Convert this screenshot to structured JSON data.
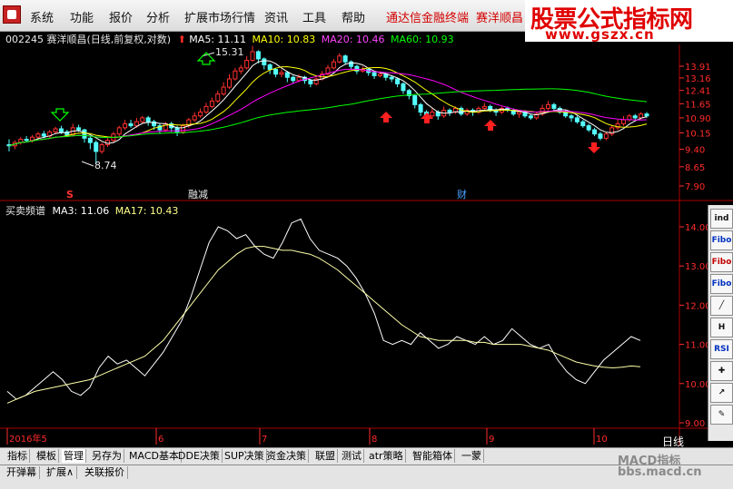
{
  "menu": {
    "items": [
      "系统",
      "功能",
      "报价",
      "分析",
      "扩展市场行情",
      "资讯",
      "工具",
      "帮助"
    ],
    "link_terminal": "通达信金融终端",
    "link_stock": "赛洋顺昌"
  },
  "watermark": {
    "title": "股票公式指标网",
    "url": "www.gszx.cn"
  },
  "header": {
    "code": "002245",
    "name_mode": "赛洋顺昌(日线,前复权,对数)",
    "ma5": "MA5: 11.11",
    "ma10": "MA10: 10.83",
    "ma20": "MA20: 10.46",
    "ma60": "MA60: 10.93"
  },
  "colors": {
    "candle_up": "#ff3030",
    "candle_down": "#54ffff",
    "ma5": "#ffffff",
    "ma10": "#ffff00",
    "ma20": "#ff00ff",
    "ma60": "#00ff00",
    "axis": "#ff2b2b",
    "grid": "#aa0000"
  },
  "annotations": {
    "high_label": "15.31",
    "low_label": "8.74",
    "marker_s": "S",
    "marker_rongzi": "融减",
    "marker_cai": "财"
  },
  "indicator": {
    "title": "买卖频谱",
    "ma3": "MA3: 11.06",
    "ma17": "MA17: 10.43"
  },
  "price_axis": [
    "13.91",
    "13.16",
    "12.41",
    "11.65",
    "10.90",
    "10.15",
    "9.40",
    "8.65",
    "7.90"
  ],
  "indicator_axis": [
    "14.00",
    "13.00",
    "12.00",
    "11.00",
    "10.00",
    "9.00"
  ],
  "date_axis": [
    "2016年5",
    "6",
    "7",
    "8",
    "9",
    "10"
  ],
  "period_label": "日线",
  "sidebar_buttons": [
    "ind",
    "Fibo",
    "Fibo",
    "Fibo",
    "H",
    "RSI"
  ],
  "tabs": [
    "指标",
    "模板",
    "管理",
    "另存为",
    "MACD基本",
    "DDE决策",
    "SUP决策",
    "资金决策",
    "联盟",
    "测试",
    "atr策略",
    "智能箱体",
    "一蒙"
  ],
  "bottom_buttons": [
    "开弹幕",
    "扩展∧",
    "关联报价"
  ],
  "macd_watermark_1": "MACD指标",
  "macd_watermark_2": "bbs.macd.cn",
  "chart_data": {
    "type": "candlestick",
    "x": [
      "2016-05",
      "2016-06",
      "2016-07",
      "2016-08",
      "2016-09",
      "2016-10"
    ],
    "ohlc_series": {
      "name": "",
      "values": [
        [
          9.6,
          9.55,
          9.85,
          9.3
        ],
        [
          9.55,
          9.7,
          9.8,
          9.4
        ],
        [
          9.7,
          9.85,
          9.95,
          9.6
        ],
        [
          9.85,
          9.8,
          10.0,
          9.7
        ],
        [
          9.8,
          9.95,
          10.05,
          9.7
        ],
        [
          9.95,
          10.1,
          10.2,
          9.85
        ],
        [
          10.1,
          10.0,
          10.25,
          9.9
        ],
        [
          10.0,
          10.2,
          10.3,
          9.9
        ],
        [
          10.2,
          10.35,
          10.45,
          10.1
        ],
        [
          10.35,
          10.2,
          10.5,
          10.1
        ],
        [
          10.2,
          10.05,
          10.3,
          9.95
        ],
        [
          10.05,
          10.4,
          10.6,
          10.0
        ],
        [
          10.4,
          10.3,
          10.55,
          10.2
        ],
        [
          10.3,
          9.9,
          10.35,
          9.7
        ],
        [
          9.9,
          9.7,
          10.0,
          9.4
        ],
        [
          9.7,
          9.3,
          9.8,
          8.74
        ],
        [
          9.3,
          9.6,
          9.7,
          9.2
        ],
        [
          9.6,
          9.8,
          9.9,
          9.5
        ],
        [
          9.8,
          10.1,
          10.2,
          9.7
        ],
        [
          10.1,
          10.4,
          10.5,
          10.0
        ],
        [
          10.4,
          10.6,
          10.8,
          10.3
        ],
        [
          10.6,
          10.5,
          10.8,
          10.4
        ],
        [
          10.5,
          10.7,
          10.9,
          10.4
        ],
        [
          10.7,
          10.9,
          11.0,
          10.6
        ],
        [
          10.9,
          10.7,
          11.0,
          10.5
        ],
        [
          10.7,
          10.5,
          10.8,
          10.3
        ],
        [
          10.5,
          10.3,
          10.6,
          10.1
        ],
        [
          10.3,
          10.6,
          10.7,
          10.2
        ],
        [
          10.6,
          10.4,
          10.7,
          10.2
        ],
        [
          10.4,
          10.2,
          10.5,
          10.0
        ],
        [
          10.2,
          10.5,
          10.6,
          10.1
        ],
        [
          10.5,
          10.8,
          10.9,
          10.4
        ],
        [
          10.8,
          11.0,
          11.2,
          10.7
        ],
        [
          11.0,
          11.2,
          11.4,
          10.9
        ],
        [
          11.2,
          11.5,
          11.7,
          11.1
        ],
        [
          11.5,
          11.8,
          12.0,
          11.4
        ],
        [
          11.8,
          12.2,
          12.4,
          11.7
        ],
        [
          12.2,
          12.6,
          12.9,
          12.1
        ],
        [
          12.6,
          13.1,
          13.4,
          12.5
        ],
        [
          13.1,
          13.6,
          13.8,
          13.0
        ],
        [
          13.6,
          13.8,
          14.0,
          13.4
        ],
        [
          13.8,
          14.3,
          14.6,
          13.7
        ],
        [
          14.3,
          14.9,
          15.31,
          14.2
        ],
        [
          14.9,
          14.4,
          15.0,
          14.1
        ],
        [
          14.4,
          14.0,
          14.5,
          13.7
        ],
        [
          14.0,
          13.7,
          14.1,
          13.4
        ],
        [
          13.7,
          13.4,
          13.8,
          13.2
        ],
        [
          13.4,
          13.5,
          13.7,
          13.2
        ],
        [
          13.5,
          13.2,
          13.6,
          12.9
        ],
        [
          13.2,
          13.0,
          13.3,
          12.8
        ],
        [
          13.0,
          13.2,
          13.4,
          12.9
        ],
        [
          13.2,
          13.0,
          13.3,
          12.8
        ],
        [
          13.0,
          12.8,
          13.1,
          12.6
        ],
        [
          12.8,
          13.1,
          13.2,
          12.7
        ],
        [
          13.1,
          13.4,
          13.6,
          13.0
        ],
        [
          13.4,
          13.8,
          14.0,
          13.3
        ],
        [
          13.8,
          14.2,
          14.4,
          13.7
        ],
        [
          14.2,
          14.6,
          14.8,
          14.1
        ],
        [
          14.6,
          14.2,
          14.7,
          14.0
        ],
        [
          14.2,
          13.9,
          14.3,
          13.7
        ],
        [
          13.9,
          13.6,
          14.0,
          13.4
        ],
        [
          13.6,
          13.7,
          13.9,
          13.5
        ],
        [
          13.7,
          13.5,
          13.8,
          13.3
        ],
        [
          13.5,
          13.3,
          13.6,
          13.1
        ],
        [
          13.3,
          13.4,
          13.6,
          13.2
        ],
        [
          13.4,
          13.2,
          13.5,
          13.0
        ],
        [
          13.2,
          13.1,
          13.3,
          12.9
        ],
        [
          13.1,
          12.8,
          13.2,
          12.6
        ],
        [
          12.8,
          12.4,
          12.9,
          12.2
        ],
        [
          12.4,
          12.1,
          12.5,
          11.9
        ],
        [
          12.1,
          11.6,
          12.2,
          11.4
        ],
        [
          11.6,
          11.2,
          11.7,
          11.0
        ],
        [
          11.2,
          11.0,
          11.3,
          10.8
        ],
        [
          11.0,
          11.2,
          11.4,
          10.9
        ],
        [
          11.2,
          11.0,
          11.3,
          10.8
        ],
        [
          11.0,
          11.3,
          11.5,
          10.9
        ],
        [
          11.3,
          11.2,
          11.4,
          11.0
        ],
        [
          11.2,
          11.4,
          11.5,
          11.1
        ],
        [
          11.4,
          11.1,
          11.5,
          11.0
        ],
        [
          11.1,
          11.3,
          11.4,
          11.0
        ],
        [
          11.3,
          11.2,
          11.4,
          11.0
        ],
        [
          11.2,
          11.4,
          11.5,
          11.1
        ],
        [
          11.4,
          11.5,
          11.7,
          11.3
        ],
        [
          11.5,
          11.3,
          11.6,
          11.2
        ],
        [
          11.3,
          11.2,
          11.4,
          11.0
        ],
        [
          11.2,
          11.4,
          11.5,
          11.1
        ],
        [
          11.4,
          11.3,
          11.5,
          11.2
        ],
        [
          11.3,
          11.1,
          11.4,
          11.0
        ],
        [
          11.1,
          11.2,
          11.3,
          10.9
        ],
        [
          11.2,
          11.0,
          11.3,
          10.9
        ],
        [
          11.0,
          10.9,
          11.1,
          10.8
        ],
        [
          10.9,
          11.1,
          11.2,
          10.8
        ],
        [
          11.1,
          11.4,
          11.6,
          11.0
        ],
        [
          11.4,
          11.6,
          11.8,
          11.3
        ],
        [
          11.6,
          11.4,
          11.7,
          11.3
        ],
        [
          11.4,
          11.2,
          11.5,
          11.1
        ],
        [
          11.2,
          11.0,
          11.3,
          10.9
        ],
        [
          11.0,
          10.9,
          11.1,
          10.7
        ],
        [
          10.9,
          10.7,
          11.0,
          10.6
        ],
        [
          10.7,
          10.5,
          10.8,
          10.4
        ],
        [
          10.5,
          10.3,
          10.6,
          10.2
        ],
        [
          10.3,
          10.1,
          10.4,
          10.0
        ],
        [
          10.1,
          9.9,
          10.2,
          9.8
        ],
        [
          9.9,
          10.1,
          10.2,
          9.8
        ],
        [
          10.1,
          10.4,
          10.5,
          10.0
        ],
        [
          10.4,
          10.6,
          10.8,
          10.3
        ],
        [
          10.6,
          10.8,
          11.0,
          10.5
        ],
        [
          10.8,
          11.0,
          11.1,
          10.7
        ],
        [
          11.0,
          10.9,
          11.1,
          10.8
        ],
        [
          10.9,
          11.1,
          11.2,
          10.8
        ],
        [
          11.1,
          11.0,
          11.2,
          10.9
        ]
      ]
    },
    "indicator_series": [
      {
        "name": "MA3",
        "values": [
          9.8,
          9.6,
          9.7,
          9.9,
          10.1,
          10.3,
          10.1,
          9.8,
          9.7,
          9.9,
          10.4,
          10.7,
          10.5,
          10.6,
          10.4,
          10.2,
          10.5,
          10.8,
          11.2,
          11.6,
          12.2,
          12.9,
          13.6,
          14.0,
          13.9,
          13.7,
          13.8,
          13.5,
          13.3,
          13.2,
          13.6,
          14.1,
          14.2,
          13.7,
          13.4,
          13.3,
          13.2,
          13.0,
          12.7,
          12.3,
          11.8,
          11.1,
          11.0,
          11.1,
          11.0,
          11.3,
          11.1,
          10.9,
          11.0,
          11.2,
          11.1,
          11.0,
          11.2,
          11.0,
          11.1,
          11.4,
          11.2,
          11.0,
          10.9,
          11.0,
          10.6,
          10.3,
          10.1,
          10.0,
          10.3,
          10.6,
          10.8,
          11.0,
          11.2,
          11.1
        ]
      },
      {
        "name": "MA17",
        "values": [
          9.5,
          9.6,
          9.7,
          9.8,
          9.85,
          9.9,
          9.95,
          10.0,
          10.05,
          10.1,
          10.2,
          10.3,
          10.4,
          10.5,
          10.6,
          10.7,
          10.9,
          11.1,
          11.4,
          11.7,
          12.0,
          12.3,
          12.6,
          12.9,
          13.1,
          13.3,
          13.45,
          13.5,
          13.5,
          13.45,
          13.4,
          13.4,
          13.35,
          13.3,
          13.2,
          13.05,
          12.9,
          12.7,
          12.5,
          12.3,
          12.1,
          11.9,
          11.7,
          11.5,
          11.35,
          11.2,
          11.15,
          11.1,
          11.1,
          11.1,
          11.1,
          11.05,
          11.05,
          11.0,
          11.0,
          11.0,
          11.0,
          10.95,
          10.9,
          10.85,
          10.75,
          10.65,
          10.55,
          10.5,
          10.45,
          10.42,
          10.4,
          10.42,
          10.45,
          10.43
        ]
      }
    ],
    "price_ylim": [
      7.9,
      13.91
    ],
    "indicator_ylim": [
      9.0,
      14.0
    ],
    "grid": false,
    "legend": "top-left"
  }
}
